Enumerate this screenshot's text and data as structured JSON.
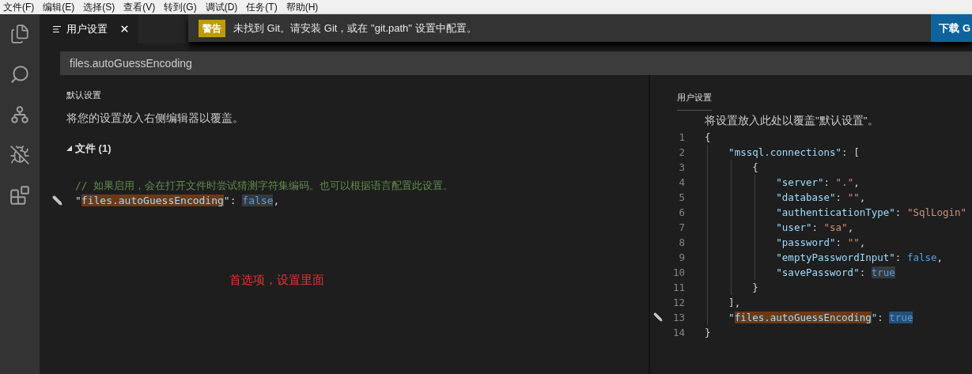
{
  "menu": [
    "文件(F)",
    "编辑(E)",
    "选择(S)",
    "查看(V)",
    "转到(G)",
    "调试(D)",
    "任务(T)",
    "帮助(H)"
  ],
  "tabs": [
    {
      "label": "用户设置",
      "selected": true
    }
  ],
  "notification": {
    "badge": "警告",
    "message": "未找到 Git。请安装 Git，或在 \"git.path\" 设置中配置。",
    "button": "下载 G"
  },
  "search": {
    "value": "files.autoGuessEncoding"
  },
  "default_settings": {
    "title": "默认设置",
    "description": "将您的设置放入右侧编辑器以覆盖。",
    "section": {
      "label": "文件 (1)",
      "expanded": true
    },
    "lines": [
      {
        "edited": false,
        "tokens": [
          {
            "kind": "comment",
            "text": "// 如果启用，会在打开文件时尝试猜测字符集编码。也可以根据语言配置此设置。"
          }
        ]
      },
      {
        "edited": true,
        "tokens": [
          {
            "kind": "key",
            "text": "\""
          },
          {
            "kind": "key",
            "text": "files.autoGuessEncoding",
            "highlight": {
              "kind": "match"
            }
          },
          {
            "kind": "key",
            "text": "\""
          },
          {
            "kind": "punct",
            "text": ": "
          },
          {
            "kind": "bool",
            "text": "false",
            "highlight": {
              "kind": "word"
            }
          },
          {
            "kind": "punct",
            "text": ","
          }
        ]
      }
    ]
  },
  "annotation": "首选项，设置里面",
  "user_settings": {
    "title": "用户设置",
    "description": "将设置放入此处以覆盖\"默认设置\"。",
    "lines": [
      {
        "number": "1",
        "edited": false,
        "tokens": [
          {
            "kind": "punct",
            "text": "{"
          }
        ]
      },
      {
        "number": "2",
        "edited": false,
        "tokens": [
          {
            "kind": "key",
            "text": "    \"mssql.connections\""
          },
          {
            "kind": "punct",
            "text": ": ["
          }
        ]
      },
      {
        "number": "3",
        "edited": false,
        "tokens": [
          {
            "kind": "punct",
            "text": "        {"
          }
        ]
      },
      {
        "number": "4",
        "edited": false,
        "tokens": [
          {
            "kind": "key",
            "text": "            \"server\""
          },
          {
            "kind": "punct",
            "text": ": "
          },
          {
            "kind": "string",
            "text": "\".\""
          },
          {
            "kind": "punct",
            "text": ","
          }
        ]
      },
      {
        "number": "5",
        "edited": false,
        "tokens": [
          {
            "kind": "key",
            "text": "            \"database\""
          },
          {
            "kind": "punct",
            "text": ": "
          },
          {
            "kind": "string",
            "text": "\"\""
          },
          {
            "kind": "punct",
            "text": ","
          }
        ]
      },
      {
        "number": "6",
        "edited": false,
        "tokens": [
          {
            "kind": "key",
            "text": "            \"authenticationType\""
          },
          {
            "kind": "punct",
            "text": ": "
          },
          {
            "kind": "string",
            "text": "\"SqlLogin\""
          }
        ]
      },
      {
        "number": "7",
        "edited": false,
        "tokens": [
          {
            "kind": "key",
            "text": "            \"user\""
          },
          {
            "kind": "punct",
            "text": ": "
          },
          {
            "kind": "string",
            "text": "\"sa\""
          },
          {
            "kind": "punct",
            "text": ","
          }
        ]
      },
      {
        "number": "8",
        "edited": false,
        "tokens": [
          {
            "kind": "key",
            "text": "            \"password\""
          },
          {
            "kind": "punct",
            "text": ": "
          },
          {
            "kind": "string",
            "text": "\"\""
          },
          {
            "kind": "punct",
            "text": ","
          }
        ]
      },
      {
        "number": "9",
        "edited": false,
        "tokens": [
          {
            "kind": "key",
            "text": "            \"emptyPasswordInput\""
          },
          {
            "kind": "punct",
            "text": ": "
          },
          {
            "kind": "bool",
            "text": "false"
          },
          {
            "kind": "punct",
            "text": ","
          }
        ]
      },
      {
        "number": "10",
        "edited": false,
        "tokens": [
          {
            "kind": "key",
            "text": "            \"savePassword\""
          },
          {
            "kind": "punct",
            "text": ": "
          },
          {
            "kind": "bool",
            "text": "true",
            "highlight": {
              "kind": "word"
            }
          }
        ]
      },
      {
        "number": "11",
        "edited": false,
        "tokens": [
          {
            "kind": "punct",
            "text": "        }"
          }
        ]
      },
      {
        "number": "12",
        "edited": false,
        "tokens": [
          {
            "kind": "punct",
            "text": "    ],"
          }
        ]
      },
      {
        "number": "13",
        "edited": true,
        "tokens": [
          {
            "kind": "key",
            "text": "    \""
          },
          {
            "kind": "key",
            "text": "files.autoGuessEncoding",
            "highlight": {
              "kind": "match"
            }
          },
          {
            "kind": "key",
            "text": "\""
          },
          {
            "kind": "punct",
            "text": ": "
          },
          {
            "kind": "bool",
            "text": "true",
            "highlight": {
              "kind": "selection"
            }
          }
        ]
      },
      {
        "number": "14",
        "edited": false,
        "tokens": [
          {
            "kind": "punct",
            "text": "}"
          }
        ]
      }
    ]
  }
}
